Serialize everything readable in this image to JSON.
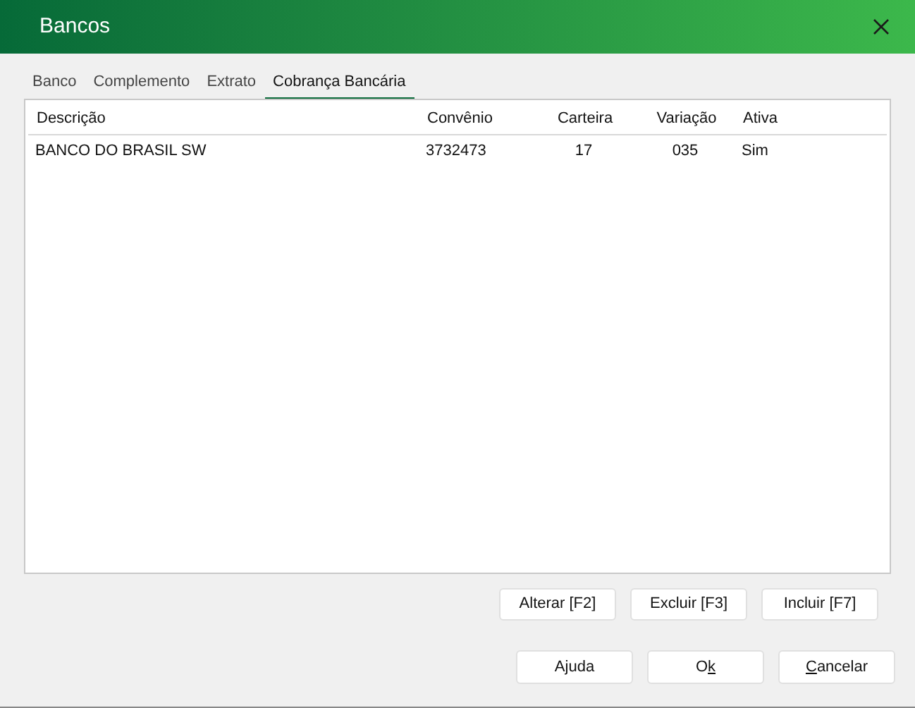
{
  "window": {
    "title": "Bancos"
  },
  "tabs": [
    {
      "label": "Banco",
      "selected": false
    },
    {
      "label": "Complemento",
      "selected": false
    },
    {
      "label": "Extrato",
      "selected": false
    },
    {
      "label": "Cobrança Bancária",
      "selected": true
    }
  ],
  "table": {
    "columns": [
      {
        "label": "Descrição"
      },
      {
        "label": "Convênio"
      },
      {
        "label": "Carteira"
      },
      {
        "label": "Variação"
      },
      {
        "label": "Ativa"
      }
    ],
    "rows": [
      [
        "BANCO DO BRASIL SW",
        "3732473",
        "17",
        "035",
        "Sim"
      ]
    ]
  },
  "actions": [
    "Alterar [F2]",
    "Excluir [F3]",
    "Incluir [F7]"
  ],
  "buttons": [
    {
      "label_parts": [
        {
          "text": "Ajuda",
          "underline": false
        }
      ]
    },
    {
      "label_parts": [
        {
          "text": "O",
          "underline": false
        },
        {
          "text": "k",
          "underline": true
        }
      ]
    },
    {
      "label_parts": [
        {
          "text": "C",
          "underline": true
        },
        {
          "text": "ancelar",
          "underline": false
        }
      ]
    }
  ]
}
